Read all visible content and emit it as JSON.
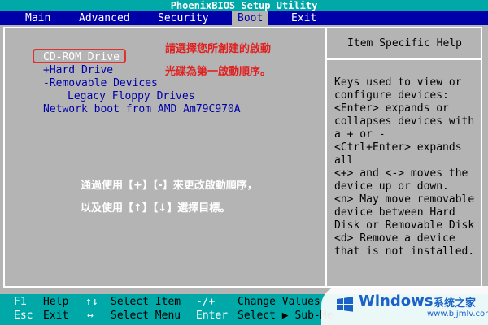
{
  "title": "PhoenixBIOS Setup Utility",
  "menu": [
    "Main",
    "Advanced",
    "Security",
    "Boot",
    "Exit"
  ],
  "active_menu": "Boot",
  "boot_list": [
    {
      "label": "CD-ROM Drive",
      "selected": true
    },
    {
      "label": "+Hard Drive",
      "selected": false
    },
    {
      "label": "-Removable Devices",
      "selected": false
    },
    {
      "label": "Legacy Floppy Drives",
      "selected": false
    },
    {
      "label": "Network boot from AMD Am79C970A",
      "selected": false
    }
  ],
  "help": {
    "title": "Item Specific Help",
    "lines": [
      "Keys used to view or",
      "configure devices:",
      "<Enter> expands or",
      "collapses devices with",
      "a + or -",
      "<Ctrl+Enter> expands",
      "all",
      "<+> and <-> moves the",
      "device up or down.",
      "<n> May move removable",
      "device between Hard",
      "Disk or Removable Disk",
      "<d> Remove a device",
      "that is not installed."
    ]
  },
  "annotations": {
    "line1": "請選擇您所創建的啟動",
    "line2": "光碟為第一啟動順序。",
    "line3": "通過使用【+】【-】來更改啟動順序，",
    "line4": "以及使用【↑】【↓】選擇目標。"
  },
  "footer": {
    "row1": [
      {
        "key": "F1",
        "desc": "Help"
      },
      {
        "key": "↑↓",
        "desc": "Select Item"
      },
      {
        "key": "-/+",
        "desc": "Change Values"
      }
    ],
    "row2": [
      {
        "key": "Esc",
        "desc": "Exit"
      },
      {
        "key": "↔",
        "desc": "Select Menu"
      },
      {
        "key": "Enter",
        "desc": "Select ▶ Sub-Me"
      }
    ]
  },
  "watermark": {
    "brand": "Windows",
    "cn": "系统之家",
    "url": "www.bjjmlv.com"
  },
  "colors": {
    "bios_blue": "#0000a8",
    "bios_cyan": "#00a8a8",
    "bios_gray": "#b4b4b4",
    "annotation_red": "#e02020"
  }
}
